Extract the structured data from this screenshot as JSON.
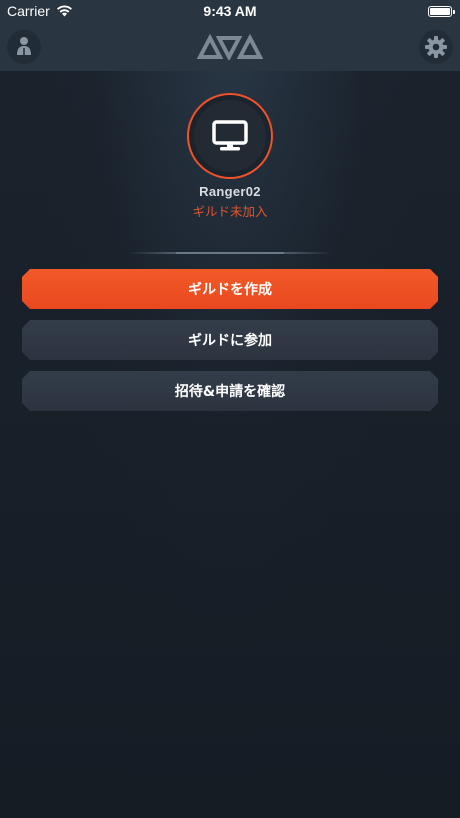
{
  "status_bar": {
    "carrier": "Carrier",
    "time": "9:43 AM",
    "icons": [
      "wifi-icon",
      "battery-icon"
    ]
  },
  "nav_bar": {
    "left_icon": "profile-icon",
    "center_icon": "triangles-logo",
    "right_icon": "gear-icon"
  },
  "profile": {
    "avatar_icon": "monitor-icon",
    "username": "Ranger02",
    "guild_status": "ギルド未加入"
  },
  "actions": {
    "create_guild": "ギルドを作成",
    "join_guild": "ギルドに参加",
    "check_invites": "招待&申請を確認"
  },
  "colors": {
    "accent": "#f0522a",
    "background": "#1b232d",
    "bar": "#2a3542",
    "secondary_button": "#303946"
  }
}
